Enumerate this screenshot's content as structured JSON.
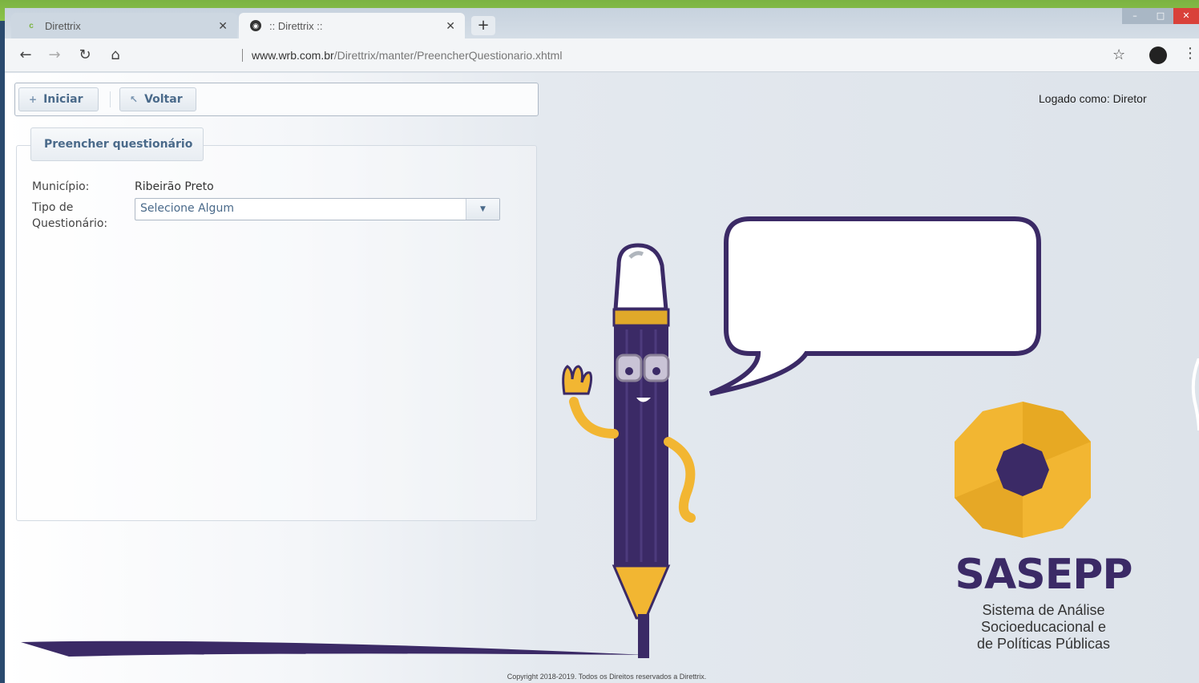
{
  "browser": {
    "tabs": [
      {
        "title": "Direttrix",
        "favicon": "c"
      },
      {
        "title": ":: Direttrix ::",
        "favicon": "globe"
      }
    ],
    "url_host": "www.wrb.com.br",
    "url_path": "/Direttrix/manter/PreencherQuestionario.xhtml"
  },
  "toolbar": {
    "iniciar_label": "Iniciar",
    "voltar_label": "Voltar"
  },
  "header": {
    "logged_as": "Logado como: Diretor"
  },
  "form": {
    "legend": "Preencher questionário",
    "municipio_label": "Município:",
    "municipio_value": "Ribeirão Preto",
    "tipo_label_line1": "Tipo de",
    "tipo_label_line2": "Questionário:",
    "tipo_selected": "Selecione Algum"
  },
  "brand": {
    "name": "SASEPP",
    "subtitle_line1": "Sistema de Análise",
    "subtitle_line2": "Socioeducacional e",
    "subtitle_line3": "de Políticas Públicas"
  },
  "footer": {
    "copyright": "Copyright 2018-2019. Todos os Direitos reservados a Direttrix."
  },
  "colors": {
    "accent": "#4a6a8a",
    "brand_purple": "#3b2a66",
    "brand_yellow": "#f2b632"
  }
}
